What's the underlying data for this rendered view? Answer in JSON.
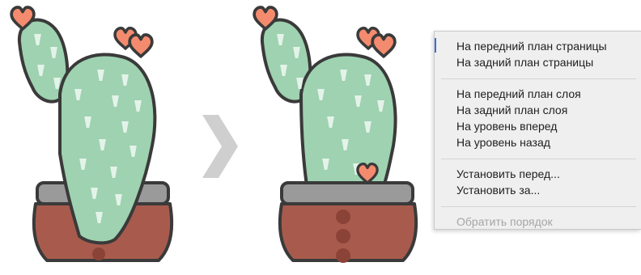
{
  "context_menu": {
    "groups": [
      {
        "items": [
          {
            "label": "На передний план страницы",
            "enabled": true
          },
          {
            "label": "На задний план страницы",
            "enabled": true
          }
        ]
      },
      {
        "items": [
          {
            "label": "На передний план слоя",
            "enabled": true
          },
          {
            "label": "На задний план слоя",
            "enabled": true
          },
          {
            "label": "На уровень вперед",
            "enabled": true
          },
          {
            "label": "На уровень назад",
            "enabled": true
          }
        ]
      },
      {
        "items": [
          {
            "label": "Установить перед...",
            "enabled": true
          },
          {
            "label": "Установить за...",
            "enabled": true
          }
        ]
      },
      {
        "items": [
          {
            "label": "Обратить порядок",
            "enabled": false
          }
        ]
      }
    ]
  },
  "colors": {
    "cactus_green": "#9ed2b0",
    "cactus_spine": "#e4f3e9",
    "flower_coral": "#f58b6e",
    "pot_brown": "#a85b4d",
    "pot_dot": "#8b4337",
    "pot_rim": "#9a9a9a",
    "outline": "#3a3a3a",
    "arrow_gray": "#cfcfcf"
  },
  "icons": [
    "before-cactus-illustration",
    "transition-arrow-icon",
    "after-cactus-illustration"
  ]
}
